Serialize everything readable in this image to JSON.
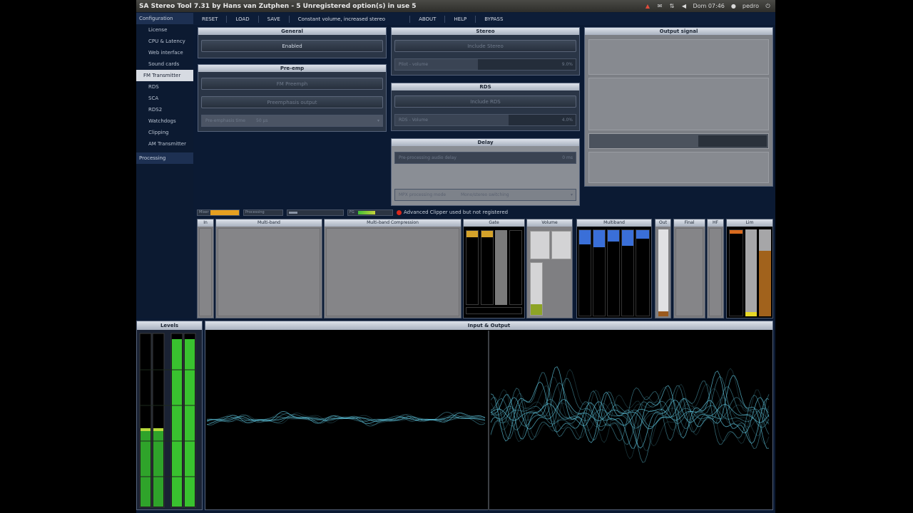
{
  "window": {
    "title": "SA Stereo Tool 7.31 by Hans van Zutphen  -  5 Unregistered option(s) in use 5",
    "clock": "Dom 07:46",
    "user": "pedro"
  },
  "toolbar": {
    "items": [
      "RESET",
      "LOAD",
      "SAVE",
      "Constant volume, increased stereo",
      "ABOUT",
      "HELP",
      "BYPASS"
    ]
  },
  "sidebar": {
    "items": [
      {
        "label": "Configuration",
        "kind": "head"
      },
      {
        "label": "License",
        "kind": "sub"
      },
      {
        "label": "CPU & Latency",
        "kind": "sub"
      },
      {
        "label": "Web interface",
        "kind": "sub"
      },
      {
        "label": "Sound cards",
        "kind": "sub"
      },
      {
        "label": "FM Transmitter",
        "kind": "active"
      },
      {
        "label": "RDS",
        "kind": "sub2"
      },
      {
        "label": "SCA",
        "kind": "sub2"
      },
      {
        "label": "RDS2",
        "kind": "sub2"
      },
      {
        "label": "Watchdogs",
        "kind": "sub2"
      },
      {
        "label": "Clipping",
        "kind": "sub2"
      },
      {
        "label": "AM Transmitter",
        "kind": "sub"
      },
      {
        "label": "Processing",
        "kind": "head"
      }
    ]
  },
  "general": {
    "title": "General",
    "enabled_label": "Enabled"
  },
  "preemp": {
    "title": "Pre-emp",
    "btn1": "FM Preemph",
    "btn2": "Preemphasis output",
    "select_label": "Pre-emphasis time",
    "select_value": "50 μs"
  },
  "stereo": {
    "title": "Stereo",
    "btn1": "Include Stereo",
    "slider_label": "Pilot - volume",
    "slider_value": "9.0%"
  },
  "rds": {
    "title": "RDS",
    "btn1": "Include RDS",
    "slider_label": "RDS - Volume",
    "slider_value": "4.0%"
  },
  "delay": {
    "title": "Delay",
    "slider_label": "Pre-processing audio delay",
    "slider_value": "0 ms",
    "select_label": "MPX processing mode",
    "select_value": "Mono/stereo switching"
  },
  "output": {
    "title": "Output signal"
  },
  "status": {
    "box1": "Mixer",
    "box2": "Processing",
    "box3": "",
    "box4": "FG",
    "warning": "Advanced Clipper used but not registered"
  },
  "meters": {
    "labels": [
      "In",
      "Multi-band",
      "Multi-band Compression",
      "Gate",
      "Volume",
      "Multiband",
      "Out",
      "Final",
      "HF",
      "Lim"
    ]
  },
  "levels": {
    "title": "Levels"
  },
  "scope": {
    "title": "Input & Output"
  },
  "colors": {
    "accent": "#5fc7e0",
    "meter_green": "#35c32b",
    "meter_orange": "#e39b22"
  }
}
